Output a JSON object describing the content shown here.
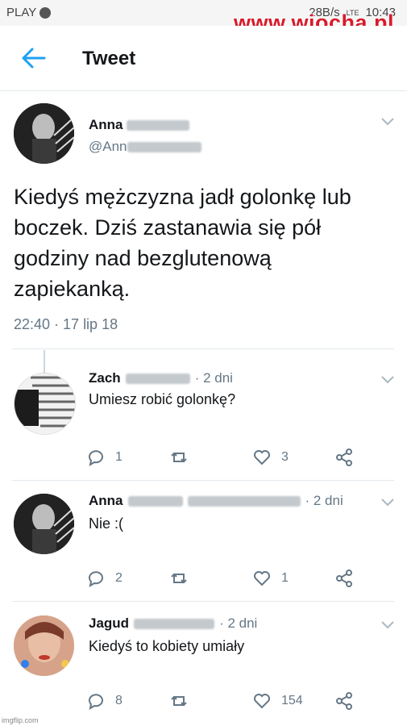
{
  "status_bar": {
    "carrier": "PLAY",
    "speed": "28B/s",
    "network": "LTE",
    "time": "10:43"
  },
  "watermark": "www.wiocha.pl",
  "header": {
    "title": "Tweet"
  },
  "main_tweet": {
    "name": "Anna",
    "handle_prefix": "@Ann",
    "text": "Kiedyś mężczyzna jadł golonkę lub boczek. Dziś zastanawia się pół godziny nad bezglutenową zapiekanką.",
    "timestamp": "22:40 · 17 lip 18"
  },
  "replies": [
    {
      "name": "Zach",
      "age": "· 2 dni",
      "text": "Umiesz robić golonkę?",
      "replies": "1",
      "retweets": "",
      "likes": "3"
    },
    {
      "name": "Anna",
      "age": "· 2 dni",
      "text": "Nie :(",
      "replies": "2",
      "retweets": "",
      "likes": "1"
    },
    {
      "name": "Jagud",
      "age": "· 2 dni",
      "text": "Kiedyś to kobiety umiały",
      "replies": "8",
      "retweets": "",
      "likes": "154"
    }
  ],
  "footer": {
    "credit": "imgflip.com"
  },
  "colors": {
    "accent": "#1da1f2",
    "secondary": "#657786",
    "divider": "#e1e8ed"
  }
}
